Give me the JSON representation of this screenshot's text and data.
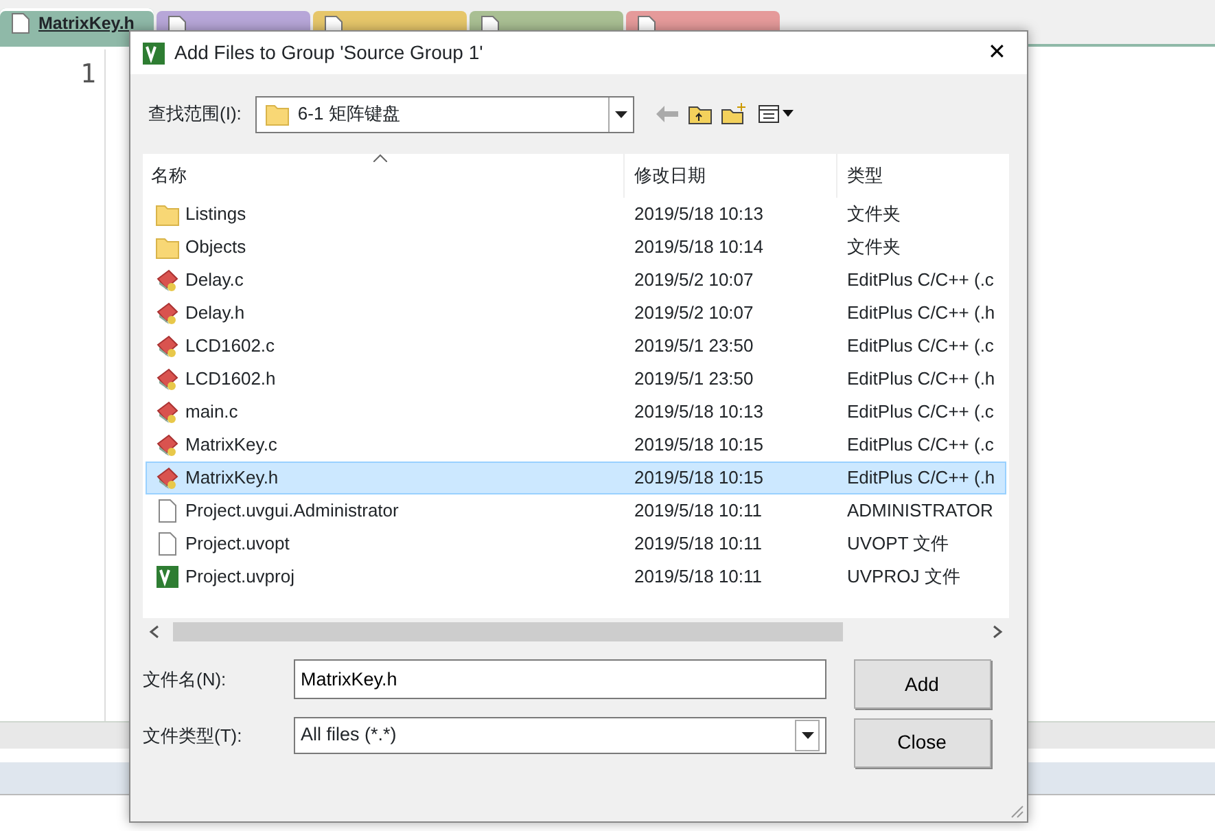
{
  "editor": {
    "tabs": [
      {
        "label": "MatrixKey.h",
        "selected": true,
        "color": "#8fb9a8"
      },
      {
        "selected": false,
        "color": "#b7a6d8"
      },
      {
        "selected": false,
        "color": "#e6c66a"
      },
      {
        "selected": false,
        "color": "#a9bf93"
      },
      {
        "selected": false,
        "color": "#e59a9a"
      }
    ],
    "line_number": "1"
  },
  "dialog": {
    "title": "Add Files to Group 'Source Group 1'",
    "close": "✕",
    "look_in": {
      "label": "查找范围(I):",
      "value": "6-1 矩阵键盘"
    },
    "columns": [
      "名称",
      "修改日期",
      "类型"
    ],
    "rows": [
      {
        "kind": "folder",
        "name": "Listings",
        "date": "2019/5/18 10:13",
        "type": "文件夹",
        "selected": false
      },
      {
        "kind": "folder",
        "name": "Objects",
        "date": "2019/5/18 10:14",
        "type": "文件夹",
        "selected": false
      },
      {
        "kind": "source",
        "name": "Delay.c",
        "date": "2019/5/2 10:07",
        "type": "EditPlus C/C++ (.c",
        "selected": false
      },
      {
        "kind": "source",
        "name": "Delay.h",
        "date": "2019/5/2 10:07",
        "type": "EditPlus C/C++ (.h",
        "selected": false
      },
      {
        "kind": "source",
        "name": "LCD1602.c",
        "date": "2019/5/1 23:50",
        "type": "EditPlus C/C++ (.c",
        "selected": false
      },
      {
        "kind": "source",
        "name": "LCD1602.h",
        "date": "2019/5/1 23:50",
        "type": "EditPlus C/C++ (.h",
        "selected": false
      },
      {
        "kind": "source",
        "name": "main.c",
        "date": "2019/5/18 10:13",
        "type": "EditPlus C/C++ (.c",
        "selected": false
      },
      {
        "kind": "source",
        "name": "MatrixKey.c",
        "date": "2019/5/18 10:15",
        "type": "EditPlus C/C++ (.c",
        "selected": false
      },
      {
        "kind": "source",
        "name": "MatrixKey.h",
        "date": "2019/5/18 10:15",
        "type": "EditPlus C/C++ (.h",
        "selected": true
      },
      {
        "kind": "file",
        "name": "Project.uvgui.Administrator",
        "date": "2019/5/18 10:11",
        "type": "ADMINISTRATOR",
        "selected": false
      },
      {
        "kind": "file",
        "name": "Project.uvopt",
        "date": "2019/5/18 10:11",
        "type": "UVOPT 文件",
        "selected": false
      },
      {
        "kind": "project",
        "name": "Project.uvproj",
        "date": "2019/5/18 10:11",
        "type": "UVPROJ 文件",
        "selected": false
      }
    ],
    "file_name": {
      "label": "文件名(N):",
      "value": "MatrixKey.h"
    },
    "file_type": {
      "label": "文件类型(T):",
      "value": "All files (*.*)"
    },
    "buttons": [
      "Add",
      "Close"
    ]
  }
}
